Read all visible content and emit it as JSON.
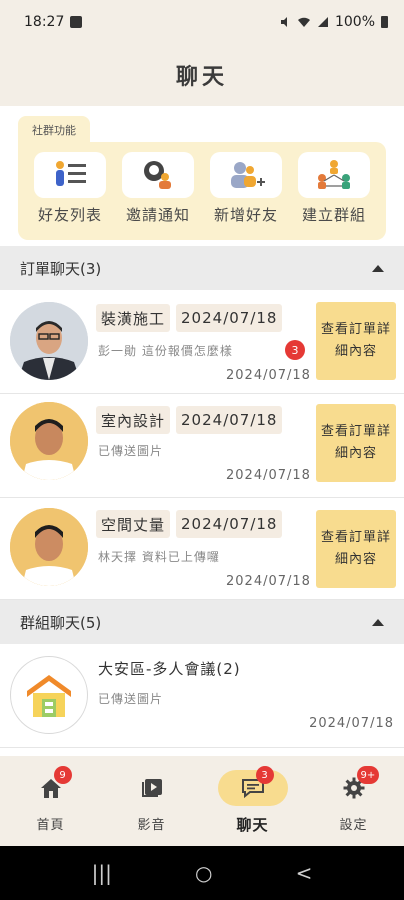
{
  "status_bar": {
    "time": "18:27",
    "battery": "100%"
  },
  "header": {
    "title": "聊天"
  },
  "social": {
    "tab_label": "社群功能",
    "items": [
      {
        "label": "好友列表",
        "icon": "friend-list-icon"
      },
      {
        "label": "邀請通知",
        "icon": "invite-notification-icon"
      },
      {
        "label": "新增好友",
        "icon": "add-friend-icon"
      },
      {
        "label": "建立群組",
        "icon": "create-group-icon"
      }
    ]
  },
  "order_chats": {
    "header": "訂單聊天(3)",
    "items": [
      {
        "tag": "裝潢施工",
        "tag_date": "2024/07/18",
        "preview": "彭一勛 這份報價怎麼樣",
        "date": "2024/07/18",
        "unread": "3",
        "button": "查看訂單詳細內容"
      },
      {
        "tag": "室內設計",
        "tag_date": "2024/07/18",
        "preview": "已傳送圖片",
        "date": "2024/07/18",
        "button": "查看訂單詳細內容"
      },
      {
        "tag": "空間丈量",
        "tag_date": "2024/07/18",
        "preview": "林天擇 資料已上傳囉",
        "date": "2024/07/18",
        "button": "查看訂單詳細內容"
      }
    ]
  },
  "group_chats": {
    "header": "群組聊天(5)",
    "items": [
      {
        "title": "大安區-多人會議(2)",
        "preview": "已傳送圖片",
        "date": "2024/07/18"
      }
    ]
  },
  "bottom_nav": {
    "items": [
      {
        "label": "首頁",
        "badge": "9",
        "icon": "home-icon"
      },
      {
        "label": "影音",
        "badge": "",
        "icon": "video-icon"
      },
      {
        "label": "聊天",
        "badge": "3",
        "icon": "chat-icon",
        "active": true
      },
      {
        "label": "設定",
        "badge": "9+",
        "icon": "settings-icon"
      }
    ]
  },
  "colors": {
    "accent": "#f8dc8f",
    "background": "#f3eee6",
    "badge": "#e53935",
    "chip": "#f4ece2",
    "section": "#ebebeb"
  }
}
